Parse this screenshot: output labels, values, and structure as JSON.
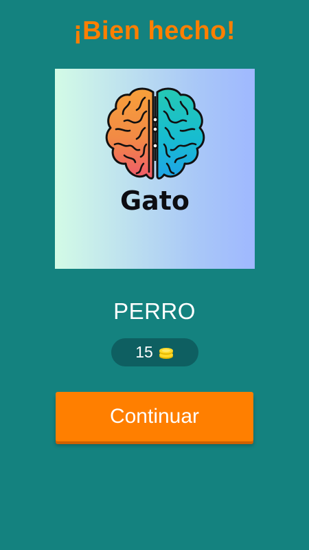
{
  "header": {
    "title": "¡Bien hecho!"
  },
  "card": {
    "word": "Gato",
    "image_icon": "brain-icon"
  },
  "answer": {
    "text": "PERRO"
  },
  "coins": {
    "count": "15",
    "icon": "coins-icon"
  },
  "actions": {
    "continue_label": "Continuar"
  },
  "colors": {
    "background": "#14827f",
    "accent": "#ff7f00",
    "coin_pill": "#0e5f61",
    "card_gradient_start": "#d3fbe6",
    "card_gradient_end": "#9fb8ff"
  }
}
